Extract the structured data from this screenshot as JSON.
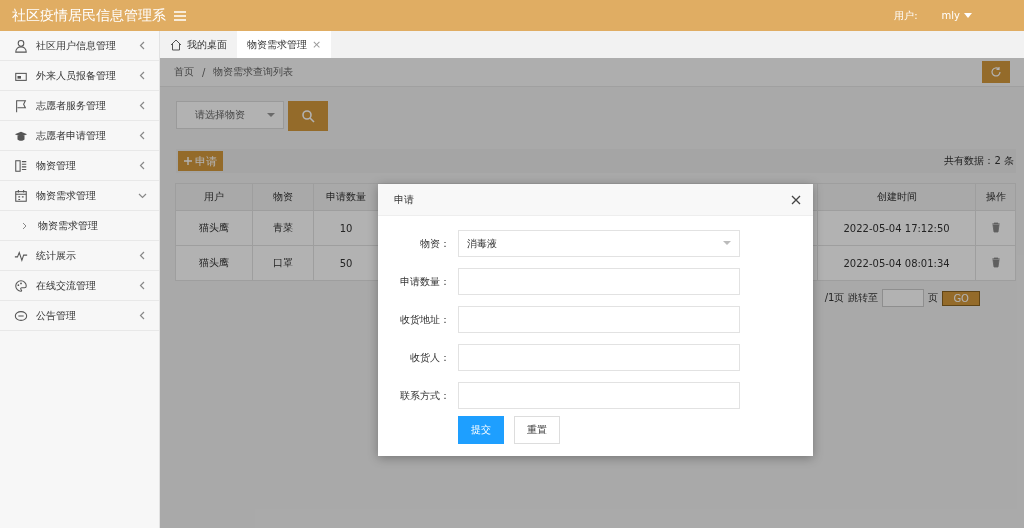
{
  "header": {
    "title": "社区疫情居民信息管理系",
    "user_label": "用户:",
    "user_name": "mly"
  },
  "sidebar": {
    "items": [
      {
        "label": "社区用户信息管理",
        "expanded": false
      },
      {
        "label": "外来人员报备管理",
        "expanded": false
      },
      {
        "label": "志愿者服务管理",
        "expanded": false
      },
      {
        "label": "志愿者申请管理",
        "expanded": false
      },
      {
        "label": "物资管理",
        "expanded": false
      },
      {
        "label": "物资需求管理",
        "expanded": true,
        "children": [
          {
            "label": "物资需求管理"
          }
        ]
      },
      {
        "label": "统计展示",
        "expanded": false
      },
      {
        "label": "在线交流管理",
        "expanded": false
      },
      {
        "label": "公告管理",
        "expanded": false
      }
    ]
  },
  "tabs": [
    {
      "label": "我的桌面",
      "kind": "home",
      "selected": false
    },
    {
      "label": "物资需求管理",
      "kind": "closable",
      "close_mark": "×",
      "selected": true
    }
  ],
  "breadcrumb": [
    "首页",
    "物资需求查询列表"
  ],
  "breadcrumb_separator": "/",
  "search": {
    "placeholder": "请选择物资"
  },
  "add_button": "申请",
  "total": "共有数据：2 条",
  "table": {
    "columns": [
      "用户",
      "物资",
      "申请数量",
      "创建时间",
      "操作"
    ],
    "rows": [
      {
        "cells": [
          "猫头鹰",
          "青菜",
          "10",
          "2022-05-04 17:12:50"
        ]
      },
      {
        "cells": [
          "猫头鹰",
          "口罩",
          "50",
          "2022-05-04 08:01:34"
        ]
      }
    ]
  },
  "pagination": {
    "pages": "/1页",
    "jump_label": "跳转至",
    "page_unit": "页",
    "go": "GO"
  },
  "dialog": {
    "title": "申请",
    "fields": [
      {
        "label": "物资：",
        "kind": "select",
        "value": "消毒液"
      },
      {
        "label": "申请数量：",
        "kind": "text"
      },
      {
        "label": "收货地址：",
        "kind": "text"
      },
      {
        "label": "收货人：",
        "kind": "text"
      },
      {
        "label": "联系方式：",
        "kind": "text"
      }
    ],
    "buttons": [
      {
        "label": "提交",
        "kind": "primary"
      },
      {
        "label": "重置",
        "kind": "plain"
      }
    ]
  }
}
